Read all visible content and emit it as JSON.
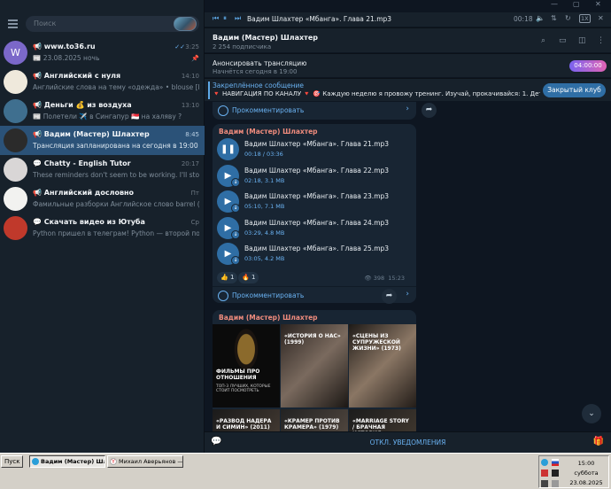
{
  "sidebar": {
    "search_placeholder": "Поиск",
    "chats": [
      {
        "avatar_text": "W",
        "avatar_color": "#7b68c9",
        "title": "📢 www.to36.ru",
        "time": "3:25",
        "msg": "📰 23.08.2025 ночь",
        "checks": "✓✓",
        "pin": "📌"
      },
      {
        "avatar_text": "",
        "avatar_color": "#efe9dc",
        "title": "📢 Английский с нуля",
        "time": "14:10",
        "msg": "Английские слова на тему «одежда» • blouse [blauz] — ..."
      },
      {
        "avatar_text": "",
        "avatar_color": "#3f6f8f",
        "title": "📢 Деньги 💰 из воздуха",
        "time": "13:10",
        "msg": "📰 Полетели ✈️ в Сингапур 🇸🇬 на халяву ?"
      },
      {
        "avatar_text": "",
        "avatar_color": "#2b2b2b",
        "title": "📢 Вадим (Мастер) Шлахтер",
        "time": "8:45",
        "msg": "Трансляция запланирована на сегодня в 19:00"
      },
      {
        "avatar_text": "",
        "avatar_color": "#d9d6d6",
        "title": "💬 Chatty - English Tutor",
        "time": "20:17",
        "msg": "These reminders don't seem to be working. I'll stop sendi..."
      },
      {
        "avatar_text": "",
        "avatar_color": "#f2f2f0",
        "title": "📢 Английский дословно",
        "time": "Пт",
        "msg": "Фамильные разборки Английское слово barrel (бочка..."
      },
      {
        "avatar_text": "",
        "avatar_color": "#c0392b",
        "title": "💬 Скачать видео из Ютуба",
        "time": "Ср",
        "msg": "Python пришел в телеграм! Python — второй по п..."
      }
    ]
  },
  "player": {
    "title": "Вадим Шлахтер «Мбанга». Глава 21.mp3",
    "time": "00:18",
    "speed": "1X"
  },
  "header": {
    "title": "Вадим (Мастер) Шлахтер",
    "subtitle": "2 254 подписчика"
  },
  "live": {
    "title": "Анонсировать трансляцию",
    "subtitle": "Начнётся сегодня в 19:00",
    "countdown": "04:00:00"
  },
  "pinned": {
    "label": "Закреплённое сообщение",
    "text": "🔻 НАВИГАЦИЯ ПО КАНАЛУ 🔻 🎯 Каждую неделю я провожу тренинг. Изучай, прокачивайся: 1. Детские ...",
    "club_button": "Закрытый клуб"
  },
  "feed": {
    "comment_label": "Прокомментировать",
    "audio_post": {
      "author": "Вадим (Мастер) Шлахтер",
      "tracks": [
        {
          "name": "Вадим Шлахтер «Мбанга». Глава 21.mp3",
          "meta": "00:18 / 03:36",
          "playing": true
        },
        {
          "name": "Вадим Шлахтер «Мбанга». Глава 22.mp3",
          "meta": "02:18, 3.1 MB",
          "playing": false
        },
        {
          "name": "Вадим Шлахтер «Мбанга». Глава 23.mp3",
          "meta": "05:10, 7.1 MB",
          "playing": false
        },
        {
          "name": "Вадим Шлахтер «Мбанга». Глава 24.mp3",
          "meta": "03:29, 4.8 MB",
          "playing": false
        },
        {
          "name": "Вадим Шлахтер «Мбанга». Глава 25.mp3",
          "meta": "03:05, 4.2 MB",
          "playing": false
        }
      ],
      "reactions": [
        {
          "emoji": "👍",
          "count": "1"
        },
        {
          "emoji": "🔥",
          "count": "1"
        }
      ],
      "views": "398",
      "time": "15:23"
    },
    "image_post": {
      "author": "Вадим (Мастер) Шлахтер",
      "images": [
        {
          "caption": "ФИЛЬМЫ ПРО ОТНОШЕНИЯ",
          "sub": "ТОП-3 ЛУЧШИХ, КОТОРЫЕ СТОИТ ПОСМОТРЕТЬ"
        },
        {
          "caption": "«ИСТОРИЯ О НАС» (1999)",
          "sub": ""
        },
        {
          "caption": "«СЦЕНЫ ИЗ СУПРУЖЕСКОЙ ЖИЗНИ» (1973)",
          "sub": ""
        },
        {
          "caption": "«РАЗВОД НАДЕРА И СИМИН» (2011)",
          "sub": ""
        },
        {
          "caption": "«КРАМЕР ПРОТИВ КРАМЕРА» (1979)",
          "sub": ""
        },
        {
          "caption": "«MARRIAGE STORY / БРАЧНАЯ ИСТОРИЯ»",
          "sub": ""
        }
      ]
    }
  },
  "bottom": {
    "mute_label": "ОТКЛ. УВЕДОМЛЕНИЯ"
  },
  "taskbar": {
    "start": "Пуск",
    "tasks": [
      {
        "label": "Вадим (Мастер) Шла...",
        "active": true
      },
      {
        "label": "Михаил Аверьянов — Я...",
        "active": false
      }
    ],
    "time": "15:00",
    "day": "суббота",
    "date": "23.08.2025"
  },
  "colors": {
    "accent": "#6ab2f2",
    "active_chat": "#2b5278",
    "author": "#f08c7d"
  }
}
